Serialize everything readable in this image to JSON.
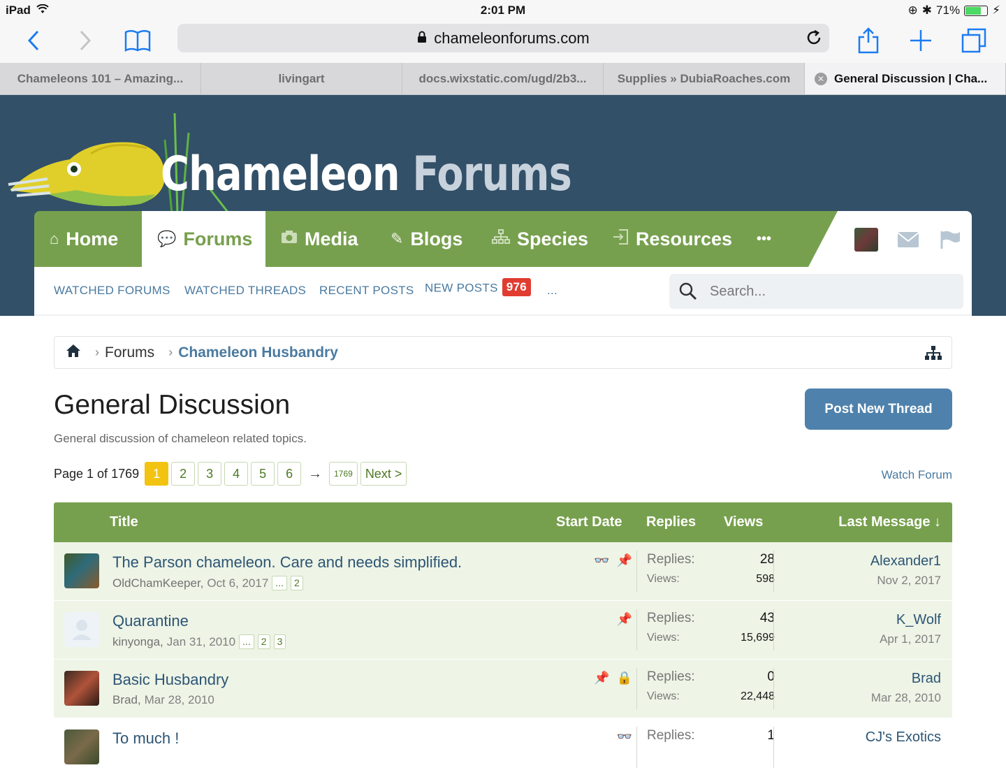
{
  "status": {
    "device": "iPad",
    "time": "2:01 PM",
    "battery": "71%",
    "battery_fill": 0.71
  },
  "browser": {
    "url": "chameleonforums.com",
    "tabs": [
      {
        "label": "Chameleons 101 – Amazing..."
      },
      {
        "label": "livingart"
      },
      {
        "label": "docs.wixstatic.com/ugd/2b3..."
      },
      {
        "label": "Supplies » DubiaRoaches.com"
      },
      {
        "label": "General Discussion | Cha..."
      }
    ]
  },
  "site": {
    "logo_word1": "Chameleon",
    "logo_word2": "Forums",
    "nav": [
      {
        "label": "Home",
        "icon": "home-icon"
      },
      {
        "label": "Forums",
        "icon": "comments-icon"
      },
      {
        "label": "Media",
        "icon": "camera-icon"
      },
      {
        "label": "Blogs",
        "icon": "pencil-icon"
      },
      {
        "label": "Species",
        "icon": "sitemap-icon"
      },
      {
        "label": "Resources",
        "icon": "download-icon"
      }
    ],
    "more_label": "•••",
    "subnav": {
      "watched_forums": "WATCHED FORUMS",
      "watched_threads": "WATCHED THREADS",
      "recent_posts": "RECENT POSTS",
      "new_posts": "NEW POSTS",
      "new_posts_count": "976",
      "more": "..."
    },
    "search_placeholder": "Search..."
  },
  "breadcrumb": {
    "forums": "Forums",
    "current": "Chameleon Husbandry"
  },
  "forum": {
    "title": "General Discussion",
    "description": "General discussion of chameleon related topics.",
    "post_button": "Post New Thread",
    "watch": "Watch Forum"
  },
  "pager": {
    "label": "Page 1 of 1769",
    "pages": [
      "1",
      "2",
      "3",
      "4",
      "5",
      "6"
    ],
    "arrow": "→",
    "last": "1769",
    "next": "Next >"
  },
  "table": {
    "headers": {
      "title": "Title",
      "start_date": "Start Date",
      "replies": "Replies",
      "views": "Views",
      "last_message": "Last Message ↓"
    },
    "replies_label": "Replies:",
    "views_label": "Views:",
    "rows": [
      {
        "title": "The Parson chameleon. Care and needs simplified.",
        "author": "OldChamKeeper,",
        "date": "Oct 6, 2017",
        "pages": [
          "...",
          "2"
        ],
        "replies": "28",
        "views": "598",
        "last_user": "Alexander1",
        "last_date": "Nov 2, 2017",
        "icons": [
          "binoculars-icon",
          "pin-icon"
        ]
      },
      {
        "title": "Quarantine",
        "author": "kinyonga,",
        "date": "Jan 31, 2010",
        "pages": [
          "...",
          "2",
          "3"
        ],
        "replies": "43",
        "views": "15,699",
        "last_user": "K_Wolf",
        "last_date": "Apr 1, 2017",
        "icons": [
          "pin-icon"
        ]
      },
      {
        "title": "Basic Husbandry",
        "author": "Brad,",
        "date": "Mar 28, 2010",
        "pages": [],
        "replies": "0",
        "views": "22,448",
        "last_user": "Brad",
        "last_date": "Mar 28, 2010",
        "icons": [
          "pin-icon",
          "lock-icon"
        ]
      },
      {
        "title": "To much !",
        "author": "",
        "date": "",
        "pages": [],
        "replies": "1",
        "views": "",
        "last_user": "CJ's Exotics",
        "last_date": "",
        "icons": [
          "binoculars-icon"
        ]
      }
    ]
  },
  "colors": {
    "header_bg": "#325068",
    "nav_green": "#77a04e",
    "accent_blue": "#4e82ac",
    "badge_red": "#e03c31",
    "page_current": "#f2c411"
  }
}
